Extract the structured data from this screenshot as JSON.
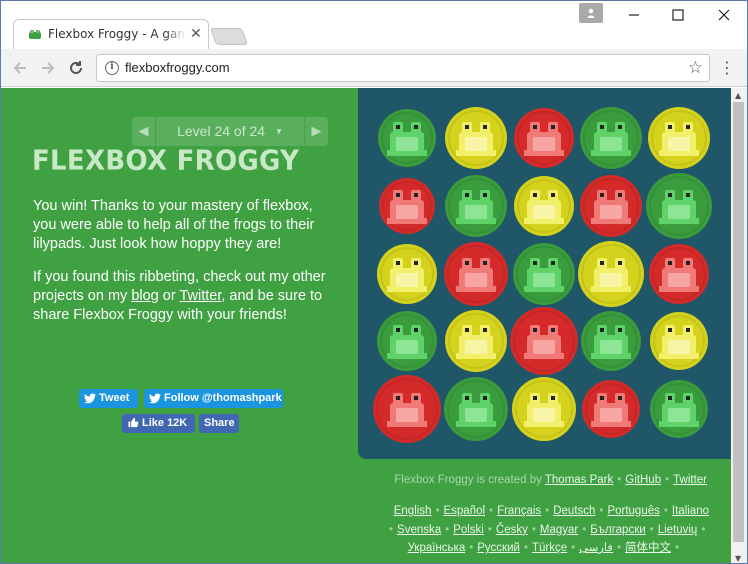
{
  "browser": {
    "tab_title": "Flexbox Froggy - A game for learning CSS flexbox",
    "tab_close": "✕",
    "url": "flexboxfroggy.com",
    "window_controls": {
      "minimize": "—",
      "maximize": "☐",
      "close": "✕"
    }
  },
  "level": {
    "prev": "◀",
    "next": "▶",
    "label": "Level 24 of 24",
    "caret": "▼"
  },
  "logo": "FLEXBOX FROGGY",
  "win_text": {
    "paragraph1": "You win! Thanks to your mastery of flexbox, you were able to help all of the frogs to their lilypads. Just look how hoppy they are!",
    "p2_before": "If you found this ribbeting, check out my other projects on my ",
    "p2_blog": "blog",
    "p2_or": " or ",
    "p2_twitter": "Twitter",
    "p2_after": ", and be sure to share Flexbox Froggy with your friends!"
  },
  "social": {
    "tweet": "Tweet",
    "follow": "Follow @thomashpark",
    "like": "Like 12K",
    "share": "Share"
  },
  "pond": {
    "colors": {
      "green": "#3a9c3d",
      "red": "#d52a2a",
      "yellow": "#d4d21c"
    },
    "pads": [
      [
        "green",
        "yellow",
        "red",
        "green",
        "yellow"
      ],
      [
        "red",
        "green",
        "yellow",
        "red",
        "green"
      ],
      [
        "yellow",
        "red",
        "green",
        "yellow",
        "red"
      ],
      [
        "green",
        "yellow",
        "red",
        "green",
        "yellow"
      ],
      [
        "red",
        "green",
        "yellow",
        "red",
        "green"
      ]
    ],
    "frogs": [
      [
        "green",
        "yellow",
        "red",
        "green",
        "yellow"
      ],
      [
        "red",
        "green",
        "yellow",
        "red",
        "green"
      ],
      [
        "yellow",
        "red",
        "green",
        "yellow",
        "red"
      ],
      [
        "green",
        "yellow",
        "red",
        "green",
        "yellow"
      ],
      [
        "red",
        "green",
        "yellow",
        "red",
        "green"
      ]
    ]
  },
  "credits": {
    "prefix": "Flexbox Froggy is created by ",
    "author": "Thomas Park",
    "github": "GitHub",
    "twitter": "Twitter"
  },
  "languages": {
    "row1": [
      "English",
      "Español",
      "Français",
      "Deutsch",
      "Português",
      "Italiano"
    ],
    "row2": [
      "Svenska",
      "Polski",
      "Česky",
      "Magyar",
      "Български",
      "Lietuvių"
    ],
    "row3": [
      "Українська",
      "Русский",
      "Türkçe",
      "فارسی",
      "简体中文"
    ]
  }
}
